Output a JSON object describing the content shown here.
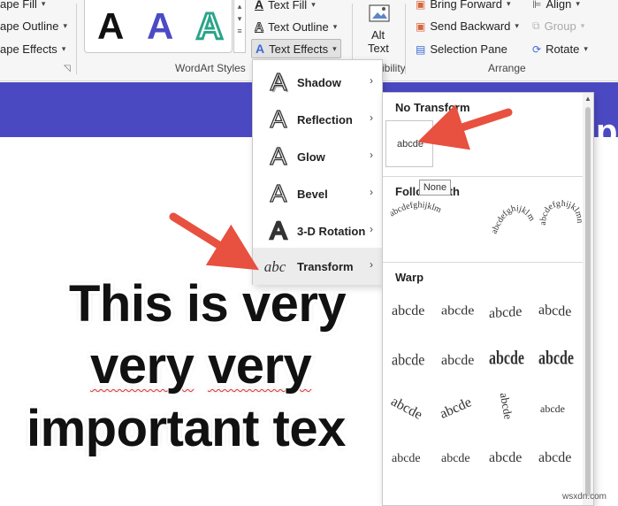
{
  "ribbon": {
    "shape_fill": "ape Fill",
    "shape_outline": "ape Outline",
    "shape_effects": "ape Effects",
    "wordart_label": "WordArt Styles",
    "wordart_letter": "A",
    "text_fill": "Text Fill",
    "text_outline": "Text Outline",
    "text_effects": "Text Effects",
    "alt_text_1": "Alt",
    "alt_text_2": "Text",
    "accessibility_fragment": "ibility",
    "bring_forward": "Bring Forward",
    "send_backward": "Send Backward",
    "selection_pane": "Selection Pane",
    "align": "Align",
    "group": "Group",
    "rotate": "Rotate",
    "arrange_label": "Arrange"
  },
  "slide": {
    "band_letter": "p",
    "line1": "This is very",
    "line2_a": "very",
    "line2_b": "very",
    "line3": "important tex"
  },
  "menu": {
    "items": [
      {
        "label": "Shadow"
      },
      {
        "label": "Reflection"
      },
      {
        "label": "Glow"
      },
      {
        "label": "Bevel"
      },
      {
        "label": "3-D Rotation"
      },
      {
        "label": "Transform"
      }
    ]
  },
  "submenu": {
    "no_transform": "No Transform",
    "none_sample": "abcde",
    "follow_path": "Follow Path",
    "warp": "Warp",
    "warp_sample": "abcde",
    "tooltip": "None"
  },
  "colors": {
    "accent": "#4b49c2",
    "arrow": "#e8503f",
    "wordart_blue": "#4b4bc4",
    "wordart_teal": "#2aa58a"
  },
  "watermark": "wsxdn.com"
}
